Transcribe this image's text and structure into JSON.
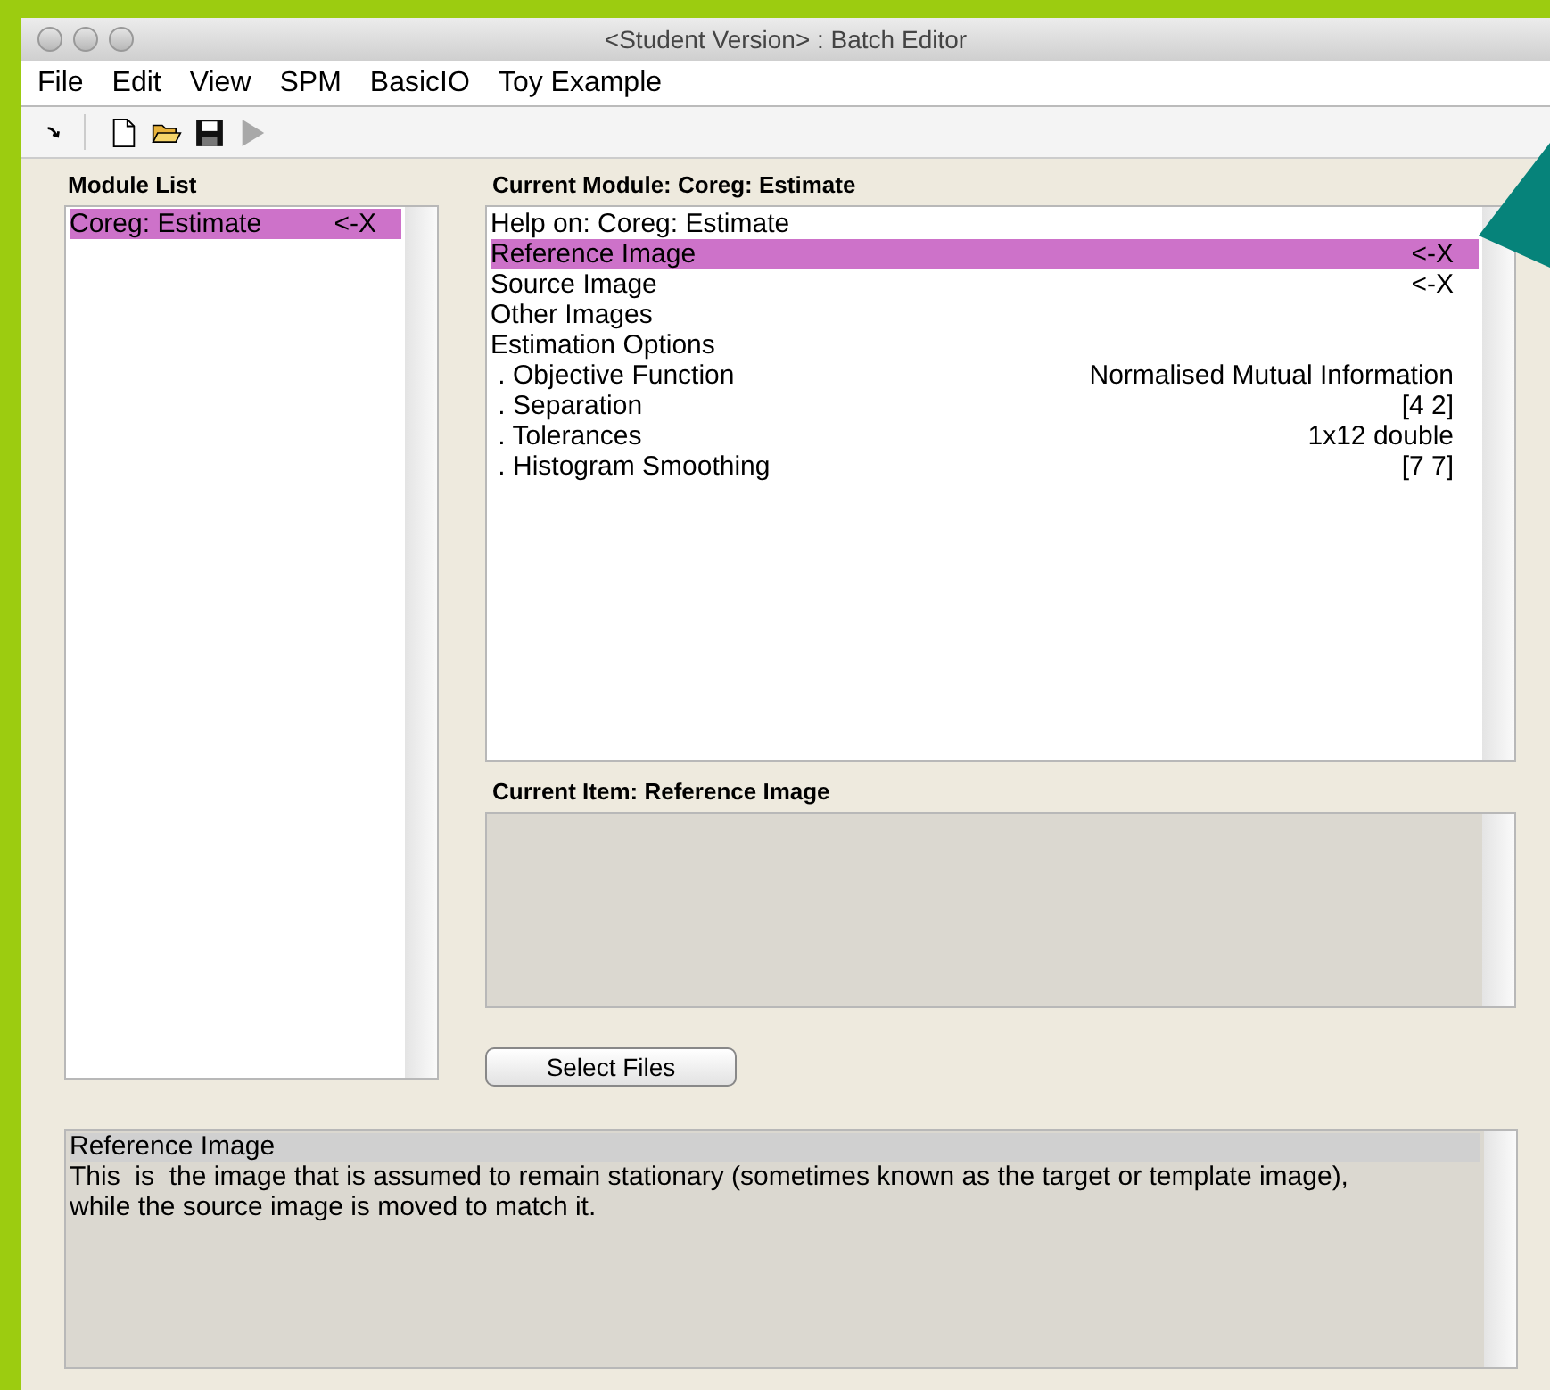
{
  "window": {
    "title": "<Student Version> : Batch Editor"
  },
  "menu": [
    "File",
    "Edit",
    "View",
    "SPM",
    "BasicIO",
    "Toy Example"
  ],
  "toolbar": [
    {
      "kind": "arrow",
      "disabled": false
    },
    {
      "kind": "new",
      "disabled": false
    },
    {
      "kind": "open",
      "disabled": false
    },
    {
      "kind": "save",
      "disabled": false
    },
    {
      "kind": "run",
      "disabled": true
    }
  ],
  "module_list": {
    "title": "Module List",
    "items": [
      {
        "label": "Coreg: Estimate",
        "value": "<-X",
        "selected": true
      }
    ]
  },
  "current_module": {
    "title": "Current Module: Coreg: Estimate",
    "rows": [
      {
        "label": "Help on: Coreg: Estimate",
        "value": "",
        "selected": false
      },
      {
        "label": "Reference Image",
        "value": "<-X",
        "selected": true
      },
      {
        "label": "Source Image",
        "value": "<-X",
        "selected": false
      },
      {
        "label": "Other Images",
        "value": "",
        "selected": false
      },
      {
        "label": "Estimation Options",
        "value": "",
        "selected": false
      },
      {
        "label": " . Objective Function",
        "value": "Normalised Mutual Information",
        "selected": false
      },
      {
        "label": " . Separation",
        "value": "[4 2]",
        "selected": false
      },
      {
        "label": " . Tolerances",
        "value": "1x12 double",
        "selected": false
      },
      {
        "label": " . Histogram Smoothing",
        "value": "[7 7]",
        "selected": false
      }
    ]
  },
  "current_item": {
    "title": "Current Item: Reference Image"
  },
  "select_button": "Select Files",
  "help": {
    "title": "Reference Image",
    "text": "This  is  the image that is assumed to remain stationary (sometimes known as the target or template image), while the source image is moved to match it."
  }
}
